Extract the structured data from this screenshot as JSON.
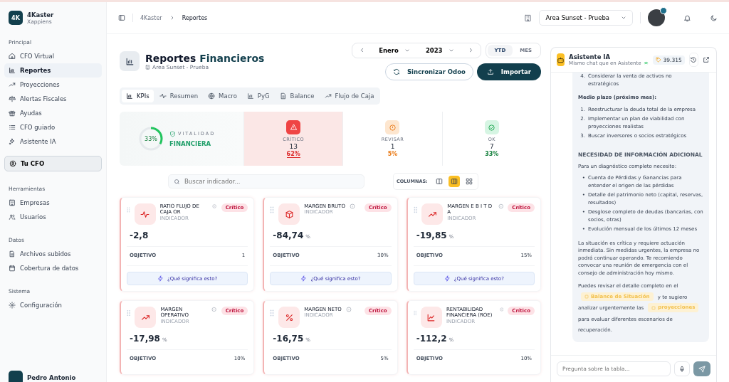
{
  "brand": {
    "logo": "4K",
    "name": "4Kaster",
    "subtitle": "Xappiens"
  },
  "sidebar": {
    "sections": [
      {
        "title": "Principal",
        "items": [
          {
            "label": "CFO Virtual",
            "selected": false
          },
          {
            "label": "Reportes",
            "selected": true
          },
          {
            "label": "Proyecciones",
            "selected": false
          },
          {
            "label": "Alertas Fiscales",
            "selected": false
          },
          {
            "label": "Ayudas",
            "selected": false
          },
          {
            "label": "CFO guiado",
            "selected": false
          },
          {
            "label": "Asistente IA",
            "selected": false
          }
        ]
      },
      {
        "title": "Herramientas",
        "items": [
          {
            "label": "Empresas",
            "selected": false
          },
          {
            "label": "Usuarios",
            "selected": false
          }
        ]
      },
      {
        "title": "Datos",
        "items": [
          {
            "label": "Archivos subidos",
            "selected": false
          },
          {
            "label": "Cobertura de datos",
            "selected": false
          }
        ]
      },
      {
        "title": "Sistema",
        "items": [
          {
            "label": "Configuración",
            "selected": false
          }
        ]
      }
    ],
    "highlight_button": "Tu CFO",
    "user": "Pedro Antonio"
  },
  "breadcrumb": [
    "4Kaster",
    "Reportes"
  ],
  "company_select": "Area Sunset - Prueba",
  "page": {
    "title_dark": "Reportes",
    "title_accent": "Financieros",
    "subtitle": "Area Sunset - Prueba"
  },
  "period": {
    "month": "Enero",
    "year": "2023",
    "modes": [
      {
        "label": "YTD",
        "selected": true
      },
      {
        "label": "MES",
        "selected": false
      }
    ]
  },
  "actions": {
    "sync": "Sincronizar Odoo",
    "import": "Importar"
  },
  "tabs": [
    {
      "label": "KPIs",
      "selected": true
    },
    {
      "label": "Resumen",
      "selected": false
    },
    {
      "label": "Macro",
      "selected": false
    },
    {
      "label": "PyG",
      "selected": false
    },
    {
      "label": "Balance",
      "selected": false
    },
    {
      "label": "Flujo de Caja",
      "selected": false
    }
  ],
  "vitality": {
    "percent": "33%",
    "level": 0.33,
    "label_top": "VITALIDAD",
    "label_bottom": "FINANCIERA"
  },
  "status_summary": [
    {
      "kind": "critical",
      "label": "CRÍTICO",
      "count": "13",
      "percent": "62%",
      "selected": true
    },
    {
      "kind": "review",
      "label": "REVISAR",
      "count": "1",
      "percent": "5%",
      "selected": false
    },
    {
      "kind": "ok",
      "label": "OK",
      "count": "7",
      "percent": "33%",
      "selected": false
    }
  ],
  "search": {
    "placeholder": "Buscar indicador..."
  },
  "columns": {
    "label": "COLUMNAS:",
    "options": [
      {
        "selected": false
      },
      {
        "selected": true
      },
      {
        "selected": false
      }
    ]
  },
  "cards": [
    {
      "name": "RATIO FLUJO DE CAJA OR",
      "sub": "INDICADOR",
      "badge": "Crítico",
      "value": "-2,8",
      "objective_label": "OBJETIVO",
      "objective": "1",
      "help": "¿Qué significa esto?"
    },
    {
      "name": "MARGEN BRUTO",
      "sub": "INDICADOR",
      "badge": "Crítico",
      "value": "-84,74",
      "unit": "%",
      "objective_label": "OBJETIVO",
      "objective": "30%",
      "help": "¿Qué significa esto?"
    },
    {
      "name": "MARGEN E B I T D A",
      "sub": "INDICADOR",
      "badge": "Crítico",
      "value": "-19,85",
      "unit": "%",
      "objective_label": "OBJETIVO",
      "objective": "15%",
      "help": "¿Qué significa esto?"
    },
    {
      "name": "MARGEN OPERATIVO",
      "sub": "INDICADOR",
      "badge": "Crítico",
      "value": "-17,98",
      "unit": "%",
      "objective_label": "OBJETIVO",
      "objective": "10%"
    },
    {
      "name": "MARGEN NETO",
      "sub": "INDICADOR",
      "badge": "Crítico",
      "value": "-16,75",
      "unit": "%",
      "objective_label": "OBJETIVO",
      "objective": "5%"
    },
    {
      "name": "RENTABILIDAD FINANCIERA (ROE)",
      "sub": "INDICADOR",
      "badge": "Crítico",
      "value": "-112,2",
      "unit": "%",
      "objective_label": "OBJETIVO",
      "objective": "10%"
    }
  ],
  "chat": {
    "title": "Asistente IA",
    "subtitle": "Mismo chat que en Asistente",
    "tokens": "39.315",
    "blocks": [
      {
        "kind": "ol",
        "items": [
          {
            "n": "4.",
            "text": "Considerar la venta de activos no estratégicos"
          }
        ]
      },
      {
        "kind": "heading",
        "text": "Medio plazo (próximo mes):"
      },
      {
        "kind": "ol",
        "items": [
          {
            "n": "1.",
            "text": "Reestructurar la deuda total de la empresa"
          },
          {
            "n": "2.",
            "text": "Implementar un plan de viabilidad con proyecciones realistas"
          },
          {
            "n": "3.",
            "text": "Buscar inversores o socios estratégicos"
          }
        ]
      },
      {
        "kind": "section",
        "text": "NECESIDAD DE INFORMACIÓN ADICIONAL"
      },
      {
        "kind": "p",
        "text": "Para un diagnóstico completo necesito:"
      },
      {
        "kind": "ul",
        "items": [
          {
            "n": "•",
            "text": "Cuenta de Pérdidas y Ganancias para entender el origen de las pérdidas"
          },
          {
            "n": "•",
            "text": "Detalle del patrimonio neto (capital, reservas, resultados)"
          },
          {
            "n": "•",
            "text": "Desglose completo de deudas (bancarias, con socios, otras)"
          },
          {
            "n": "•",
            "text": "Evolución mensual de los últimos 12 meses"
          }
        ]
      },
      {
        "kind": "p",
        "text": "La situación es crítica y requiere actuación inmediata. Sin medidas urgentes, la empresa no podrá continuar operando. Te recomiendo convocar una reunión de emergencia con el consejo de administración hoy mismo."
      },
      {
        "kind": "links",
        "parts": [
          {
            "kind": "text",
            "text": "Puedes revisar el detalle completo en el"
          },
          {
            "kind": "chip",
            "text": "Balance de Situación"
          },
          {
            "kind": "text",
            "text": "y te sugiero analizar urgentemente las"
          },
          {
            "kind": "chip",
            "text": "proyecciones"
          },
          {
            "kind": "text",
            "text": "para evaluar diferentes escenarios de recuperación."
          }
        ]
      }
    ],
    "input_placeholder": "Pregunta sobre la tabla..."
  }
}
